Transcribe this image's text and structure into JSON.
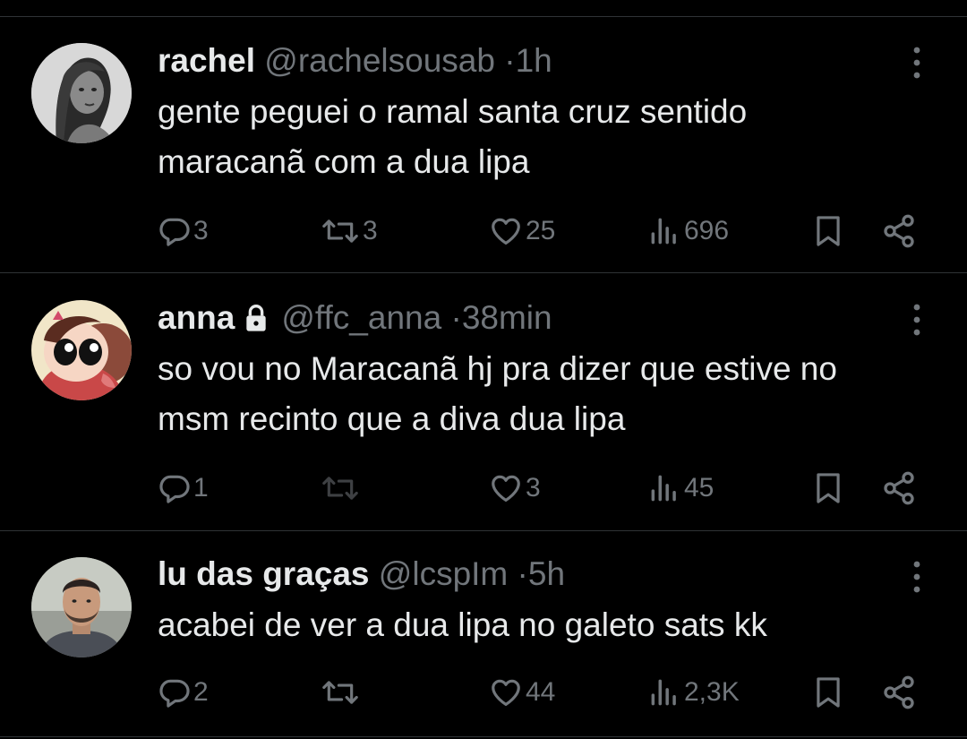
{
  "colors": {
    "background": "#000000",
    "text": "#e7e9ea",
    "secondary": "#71767b",
    "divider": "#2f3336"
  },
  "tweets": [
    {
      "name": "rachel",
      "handle": "@rachelsousab",
      "sep": "·",
      "time": "1h",
      "locked": false,
      "text_lines": [
        "gente peguei o ramal santa cruz sentido",
        "maracanã com a dua lipa"
      ],
      "replies": "3",
      "retweets": "3",
      "likes": "25",
      "views": "696",
      "avatar": "grayscale-portrait-avatar"
    },
    {
      "name": "anna",
      "handle": "@ffc_anna",
      "sep": "·",
      "time": "38min",
      "locked": true,
      "text_lines": [
        "so vou no Maracanã hj pra dizer que estive no",
        "msm recinto que a diva dua lipa"
      ],
      "replies": "1",
      "retweets": "",
      "likes": "3",
      "views": "45",
      "avatar": "cartoon-character-avatar"
    },
    {
      "name": "lu das graças",
      "handle": "@lcspIm",
      "sep": "·",
      "time": "5h",
      "locked": false,
      "text_lines": [
        "acabei de ver a dua lipa no galeto sats kk"
      ],
      "replies": "2",
      "retweets": "",
      "likes": "44",
      "views": "2,3K",
      "avatar": "man-portrait-avatar"
    }
  ],
  "icons": [
    "more-icon",
    "reply-icon",
    "retweet-icon",
    "like-icon",
    "views-icon",
    "bookmark-icon",
    "share-icon",
    "lock-icon"
  ]
}
